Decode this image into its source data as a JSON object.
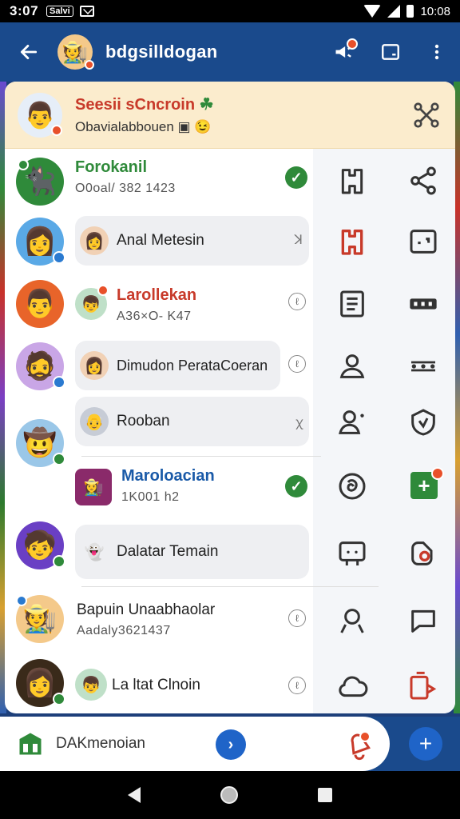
{
  "status_bar": {
    "time": "3:07",
    "badge": "Salvi",
    "battery_text": "10:08"
  },
  "app_bar": {
    "title": "bdgsilldogan",
    "back_icon": "arrow-left-icon"
  },
  "banner": {
    "title": "Seesii sCncroin",
    "emoji": "☘",
    "subtitle": "Obavialabbouen",
    "subtitle_emoji": "😉"
  },
  "contacts": [
    {
      "name": "Forokanil",
      "meta": "O0oal/ 382 1423",
      "verified": true
    },
    {
      "name": "Anal Metesin",
      "type": "bubble"
    },
    {
      "name": "Larollekan",
      "meta": "A36×O- K47"
    },
    {
      "name": "Dimudon PerataCoeran",
      "type": "bubble"
    },
    {
      "name": "Rooban",
      "type": "bubble"
    },
    {
      "name": "Maroloacian",
      "meta": "1K001 h2",
      "verified": true
    },
    {
      "name": "Dalatar Temain",
      "type": "bubble"
    },
    {
      "name": "Bapuin Unaabhaolar",
      "meta": "Aadaly3621437"
    },
    {
      "name": "La ltat Clnoin"
    }
  ],
  "bottom_bar": {
    "label": "DAKmenoian"
  },
  "colors": {
    "primary": "#1a4a8c",
    "accent": "#1f64c8",
    "green": "#2f8a3a",
    "red": "#c83a2a",
    "banner": "#fbeccd"
  }
}
